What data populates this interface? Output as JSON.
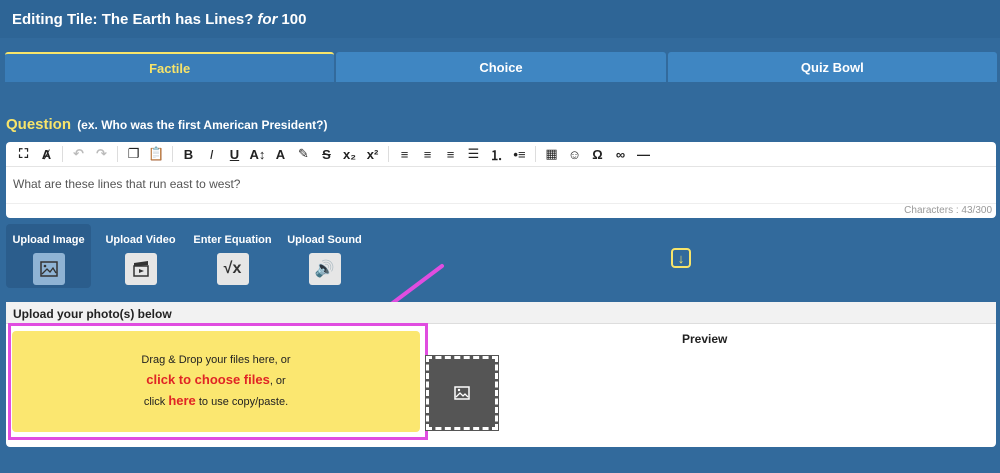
{
  "title": {
    "prefix": "Editing Tile: The Earth has Lines?",
    "for": "for",
    "points": "100"
  },
  "tabs": [
    {
      "label": "Factile",
      "active": true
    },
    {
      "label": "Choice",
      "active": false
    },
    {
      "label": "Quiz Bowl",
      "active": false
    }
  ],
  "question": {
    "label": "Question",
    "hint": "(ex. Who was the first American President?)",
    "value": "What are these lines that run east to west?",
    "char_count": "Characters : 43/300"
  },
  "toolbar": {
    "icons": [
      "fullscreen-icon",
      "clear-format-icon",
      "undo-icon",
      "redo-icon",
      "copy-icon",
      "paste-icon",
      "bold-icon",
      "italic-icon",
      "underline-icon",
      "font-size-icon",
      "text-color-icon",
      "highlight-icon",
      "strikethrough-icon",
      "subscript-icon",
      "superscript-icon",
      "align-left-icon",
      "align-center-icon",
      "align-right-icon",
      "justify-icon",
      "ordered-list-icon",
      "unordered-list-icon",
      "table-icon",
      "emoji-icon",
      "special-char-icon",
      "link-icon",
      "horizontal-rule-icon"
    ]
  },
  "media": {
    "upload_image": "Upload Image",
    "upload_video": "Upload Video",
    "enter_equation": "Enter Equation",
    "upload_sound": "Upload Sound"
  },
  "upload": {
    "header": "Upload your photo(s) below",
    "line1": "Drag & Drop your files here, or",
    "choose_link": "click to choose files",
    "line2_suffix": ", or",
    "line3_prefix": "click",
    "here_link": "here",
    "line3_suffix": "to use copy/paste.",
    "preview_label": "Preview"
  },
  "colors": {
    "background": "#326a9c",
    "accent_yellow": "#f7e46a",
    "annotation_magenta": "#e04de0",
    "link_red": "#e02525"
  }
}
